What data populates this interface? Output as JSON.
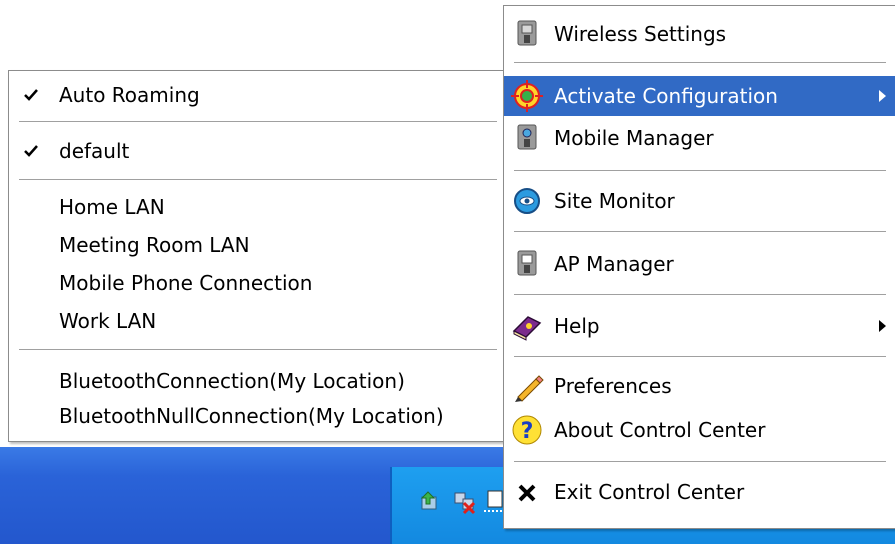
{
  "submenu": {
    "items": [
      {
        "label": "Auto Roaming",
        "checked": true
      },
      {
        "label": "default",
        "checked": true
      },
      {
        "label": "Home LAN"
      },
      {
        "label": "Meeting Room LAN"
      },
      {
        "label": "Mobile Phone Connection"
      },
      {
        "label": "Work LAN"
      },
      {
        "label": "BluetoothConnection(My Location)"
      },
      {
        "label": "BluetoothNullConnection(My Location)"
      }
    ]
  },
  "main_menu": {
    "items": [
      {
        "label": "Wireless Settings",
        "icon": "wireless-settings-icon"
      },
      {
        "label": "Activate Configuration",
        "icon": "target-icon",
        "highlighted": true,
        "has_submenu": true
      },
      {
        "label": "Mobile Manager",
        "icon": "mobile-manager-icon"
      },
      {
        "label": "Site Monitor",
        "icon": "site-monitor-icon"
      },
      {
        "label": "AP Manager",
        "icon": "ap-manager-icon"
      },
      {
        "label": "Help",
        "icon": "help-book-icon",
        "has_submenu": true
      },
      {
        "label": "Preferences",
        "icon": "pencil-icon"
      },
      {
        "label": "About Control Center",
        "icon": "question-icon"
      },
      {
        "label": "Exit Control Center",
        "icon": "close-icon"
      }
    ]
  },
  "colors": {
    "highlight": "#316ac5",
    "taskbar": "#2a63d8",
    "tray": "#1389e0"
  }
}
